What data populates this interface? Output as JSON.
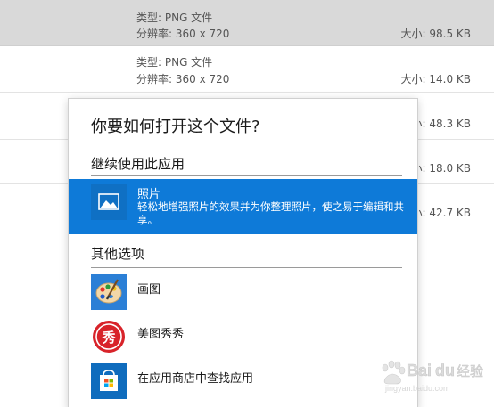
{
  "file_list": {
    "rows": [
      {
        "type": "类型: PNG 文件",
        "resolution": "分辨率: 360 x 720",
        "size": "大小: 98.5 KB",
        "selected": true
      },
      {
        "type": "类型: PNG 文件",
        "resolution": "分辨率: 360 x 720",
        "size": "大小: 14.0 KB",
        "selected": false
      }
    ],
    "partial_sizes": [
      "小: 48.3 KB",
      "小: 18.0 KB",
      "小: 42.7 KB"
    ]
  },
  "dialog": {
    "title": "你要如何打开这个文件?",
    "keep_using_heading": "继续使用此应用",
    "recommended": {
      "name": "照片",
      "description": "轻松地增强照片的效果并为你整理照片，使之易于编辑和共享。",
      "icon": "photos-icon"
    },
    "other_options_heading": "其他选项",
    "options": [
      {
        "label": "画图",
        "icon": "paint-icon"
      },
      {
        "label": "美图秀秀",
        "icon": "meitu-icon"
      },
      {
        "label": "在应用商店中查找应用",
        "icon": "store-icon"
      }
    ]
  },
  "colors": {
    "accent": "#0e7ad8",
    "selected_row": "#d9d9d9",
    "meitu_red": "#d8232a",
    "store_blue": "#0f6cbd"
  },
  "watermark": {
    "brand": "Baidu 经验",
    "url": "jingyan.baidu.com"
  }
}
